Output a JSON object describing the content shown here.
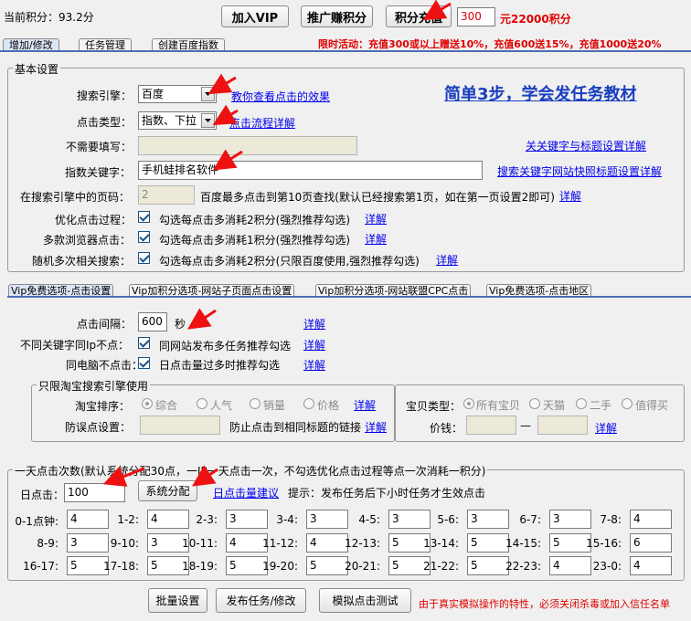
{
  "header": {
    "points_label": "当前积分：93.2分",
    "join_vip": "加入VIP",
    "promote_earn": "推广赚积分",
    "recharge": "积分充值",
    "recharge_amount": "300",
    "recharge_result": "元22000积分",
    "promo": "限时活动：充值300或以上赠送10%，充值600送15%，充值1000送20%"
  },
  "main_tabs": [
    "增加/修改",
    "任务管理",
    "创建百度指数"
  ],
  "basic": {
    "title": "基本设置",
    "engine_label": "搜索引擎：",
    "engine_value": "百度",
    "engine_help": "教你查看点击的效果",
    "slogan": "简单3步，学会发任务教材",
    "click_type_label": "点击类型：",
    "click_type_value": "指数、下拉",
    "click_type_help": "点击流程详解",
    "no_fill_label": "不需要填写：",
    "keyword_title_help": "关关键字与标题设置详解",
    "index_kw_label": "指数关键字：",
    "index_kw_value": "手机蛙排名软件",
    "search_kw_help": "搜索关键字网站快照标题设置详解",
    "page_label": "在搜索引擎中的页码：",
    "page_value": "2",
    "page_note": "百度最多点击到第10页查找(默认已经搜索第1页，如在第一页设置2即可)",
    "detail": "详解",
    "opt_label": "优化点击过程：",
    "opt_text": "勾选每点击多消耗2积分(强烈推荐勾选)",
    "browser_label": "多款浏览器点击：",
    "browser_text": "勾选每点击多消耗1积分(强烈推荐勾选)",
    "random_label": "随机多次相关搜索：",
    "random_text": "勾选每点击多消耗2积分(只限百度使用,强烈推荐勾选)"
  },
  "vip_tabs": [
    "Vip免费选项-点击设置",
    "Vip加积分选项-网站子页面点击设置",
    "Vip加积分选项-网站联盟CPC点击",
    "Vip免费选项-点击地区"
  ],
  "vip": {
    "interval_label": "点击间隔：",
    "interval_value": "600",
    "interval_unit": "秒",
    "diff_kw_label": "不同关键字同Ip不点：",
    "diff_kw_text": "同网站发布多任务推荐勾选",
    "same_pc_label": "同电脑不点击：",
    "same_pc_text": "日点击量过多时推荐勾选",
    "taobao_title": "只限淘宝搜索引擎使用",
    "sort_label": "淘宝排序：",
    "sort_options": [
      "综合",
      "人气",
      "销量",
      "价格"
    ],
    "misclick_label": "防误点设置：",
    "misclick_note": "防止点击到相同标题的链接",
    "item_type_label": "宝贝类型：",
    "item_types": [
      "所有宝贝",
      "天猫",
      "二手",
      "值得买"
    ],
    "price_label": "价钱：",
    "price_dash": "—"
  },
  "daily": {
    "title": "一天点击次数(默认系统分配30点，一IP一天点击一次，不勾选优化点击过程等点一次消耗一积分)",
    "daily_label": "日点击：",
    "daily_value": "100",
    "system_assign": "系统分配",
    "suggest_link": "日点击量建议",
    "tip": "提示：发布任务后下小时任务才生效点击",
    "hours": [
      {
        "label": "0-1点钟:",
        "value": "4"
      },
      {
        "label": "1-2:",
        "value": "4"
      },
      {
        "label": "2-3:",
        "value": "3"
      },
      {
        "label": "3-4:",
        "value": "3"
      },
      {
        "label": "4-5:",
        "value": "3"
      },
      {
        "label": "5-6:",
        "value": "3"
      },
      {
        "label": "6-7:",
        "value": "3"
      },
      {
        "label": "7-8:",
        "value": "4"
      },
      {
        "label": "8-9:",
        "value": "3"
      },
      {
        "label": "9-10:",
        "value": "3"
      },
      {
        "label": "10-11:",
        "value": "4"
      },
      {
        "label": "11-12:",
        "value": "4"
      },
      {
        "label": "12-13:",
        "value": "5"
      },
      {
        "label": "13-14:",
        "value": "5"
      },
      {
        "label": "14-15:",
        "value": "5"
      },
      {
        "label": "15-16:",
        "value": "6"
      },
      {
        "label": "16-17:",
        "value": "5"
      },
      {
        "label": "17-18:",
        "value": "5"
      },
      {
        "label": "18-19:",
        "value": "5"
      },
      {
        "label": "19-20:",
        "value": "5"
      },
      {
        "label": "20-21:",
        "value": "5"
      },
      {
        "label": "21-22:",
        "value": "5"
      },
      {
        "label": "22-23:",
        "value": "4"
      },
      {
        "label": "23-0:",
        "value": "4"
      }
    ]
  },
  "footer": {
    "batch": "批量设置",
    "publish": "发布任务/修改",
    "simulate": "模拟点击测试",
    "warning": "由于真实模拟操作的特性，必须关闭杀毒或加入信任名单"
  },
  "colors": {
    "accent_red": "#e00000",
    "link_blue": "#0000ee",
    "slogan_blue": "#1a3fbf",
    "tab_line": "#4e6cb3"
  }
}
